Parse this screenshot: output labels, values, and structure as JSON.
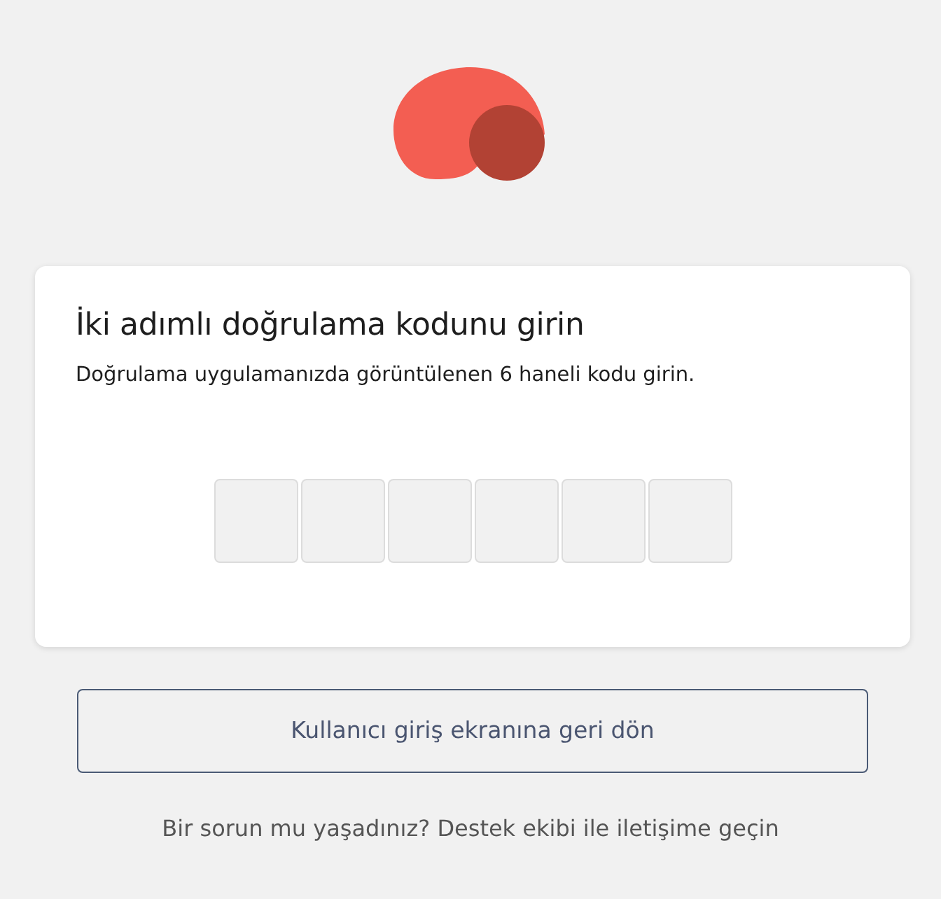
{
  "card": {
    "title": "İki adımlı doğrulama kodunu girin",
    "subtitle": "Doğrulama uygulamanızda görüntülenen 6 haneli kodu girin.",
    "code_fields": [
      {
        "kind": "digit"
      },
      {
        "kind": "digit"
      },
      {
        "kind": "digit"
      },
      {
        "kind": "digit"
      },
      {
        "kind": "digit"
      },
      {
        "kind": "digit"
      }
    ]
  },
  "back_button": "Kullanıcı giriş ekranına geri dön",
  "help_text": "Bir sorun mu yaşadınız? Destek ekibi ile iletişime geçin"
}
